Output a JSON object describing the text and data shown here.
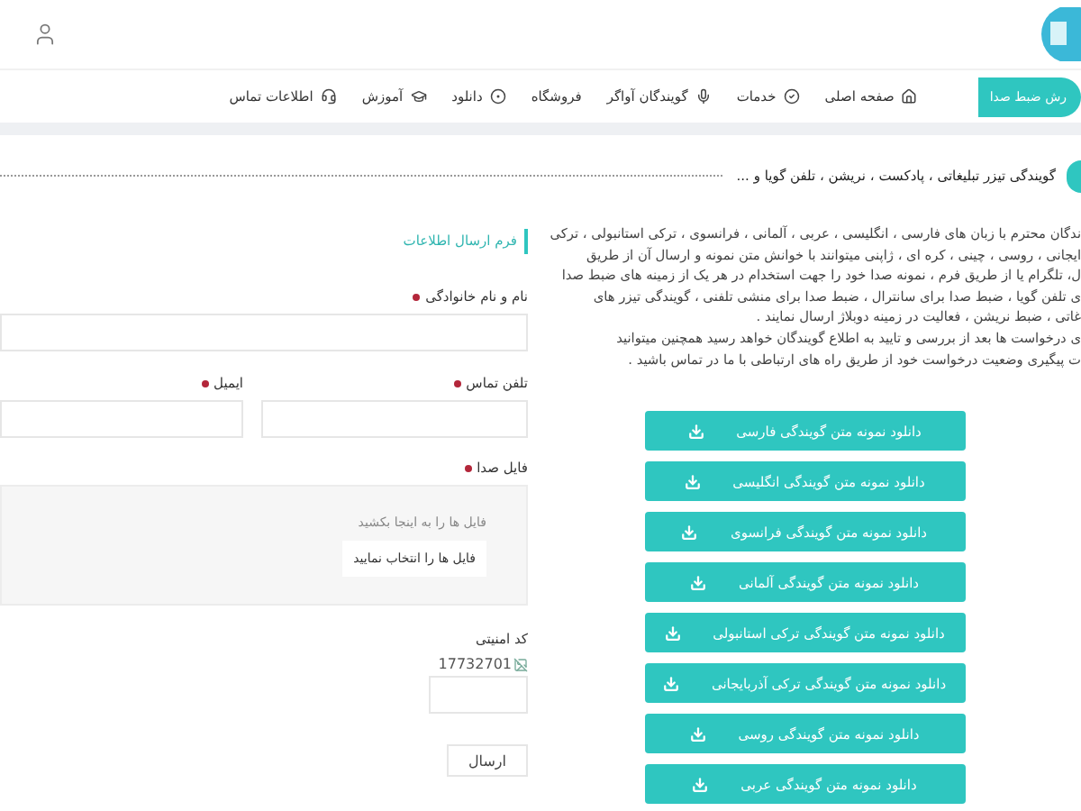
{
  "nav": {
    "cta": "رش ضبط صدا",
    "items": [
      {
        "label": "صفحه اصلی"
      },
      {
        "label": "خدمات"
      },
      {
        "label": "گویندگان آواگر"
      },
      {
        "label": "فروشگاه"
      },
      {
        "label": "دانلود"
      },
      {
        "label": "آموزش"
      },
      {
        "label": "اطلاعات تماس"
      }
    ]
  },
  "ticker": {
    "text": "گویندگی تیزر تبلیغاتی ، پادکست ، نریشن ، تلفن گویا و ..."
  },
  "intro": {
    "lines": [
      "ندگان محترم با زبان های فارسی ، انگلیسی ، عربی ، آلمانی ، فرانسوی ، ترکی استانبولی ، ترکی",
      "ایجانی ، روسی ، چینی ، کره ای ، ژاپنی میتوانند با خوانش متن نمونه و ارسال آن از طریق",
      "ل، تلگرام یا از طریق فرم ، نمونه صدا خود را جهت استخدام در هر یک از زمینه های ضبط صدا",
      "ی تلفن گویا ، ضبط صدا برای سانترال ، ضبط صدا برای منشی تلفنی ، گویندگی تیزر های",
      "غاتی ، ضبط نریشن ، فعالیت در زمینه دوبلاژ ارسال نمایند .",
      "ی درخواست ها بعد از بررسی و تایید به اطلاع گویندگان خواهد رسید همچنین میتوانید",
      "ت پیگیری وضعیت درخواست خود از طریق راه های ارتباطی با ما در تماس باشید ."
    ]
  },
  "downloads": [
    "دانلود نمونه متن گویندگی فارسی",
    "دانلود نمونه متن گویندگی انگلیسی",
    "دانلود نمونه متن گویندگی فرانسوی",
    "دانلود نمونه متن گویندگی آلمانی",
    "دانلود نمونه متن گویندگی ترکی استانبولی",
    "دانلود نمونه متن گویندگی ترکی آذربایجانی",
    "دانلود نمونه متن گویندگی روسی",
    "دانلود نمونه متن گویندگی عربی"
  ],
  "form": {
    "title": "فرم ارسال اطلاعات",
    "name": {
      "label": "نام و نام خانوادگی",
      "required": true
    },
    "phone": {
      "label": "تلفن تماس",
      "required": true
    },
    "email": {
      "label": "ایمیل",
      "required": true
    },
    "file": {
      "label": "فایل صدا",
      "required": true,
      "hint": "فایل ها را به اینجا بکشید",
      "button": "فایل ها را انتخاب نمایید"
    },
    "captcha": {
      "label": "کد امنیتی",
      "image_text": "17732701"
    },
    "submit": "ارسال"
  }
}
